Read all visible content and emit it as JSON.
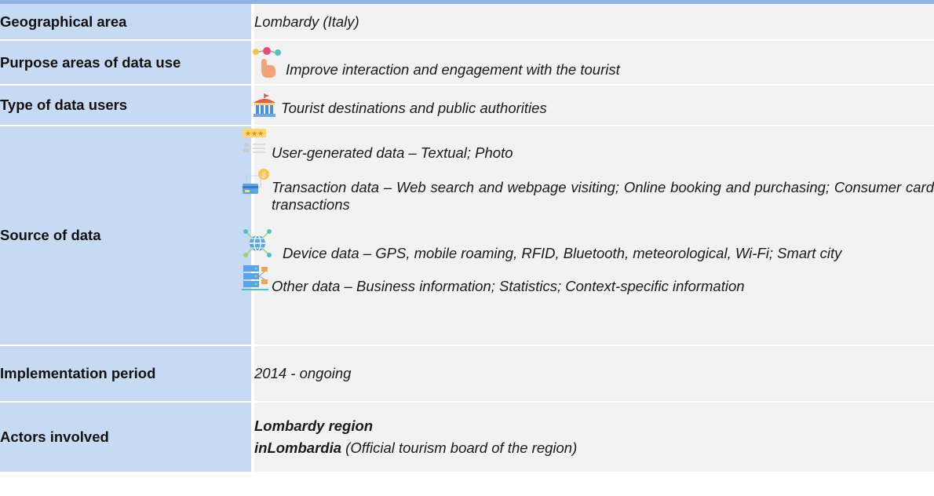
{
  "rows": {
    "geo": {
      "label": "Geographical area",
      "value": "Lombardy (Italy)"
    },
    "purpose": {
      "label": "Purpose areas of data use",
      "value": "Improve interaction and engagement with the tourist"
    },
    "users": {
      "label": "Type of data users",
      "value": "Tourist destinations and public authorities"
    },
    "source": {
      "label": "Source of data",
      "items": [
        {
          "icon": "review-stars-icon",
          "text": "User-generated data – Textual; Photo"
        },
        {
          "icon": "payment-card-icon",
          "text": "Transaction data – Web search and webpage visiting; Online booking and purchasing; Consumer card transactions"
        },
        {
          "icon": "globe-network-icon",
          "text": "Device data – GPS, mobile roaming, RFID, Bluetooth, meteorological, Wi-Fi; Smart city"
        },
        {
          "icon": "server-icon",
          "text": "Other data – Business information; Statistics; Context-specific information"
        }
      ]
    },
    "period": {
      "label": "Implementation period",
      "value": "2014 - ongoing"
    },
    "actors": {
      "label": "Actors involved",
      "line1": "Lombardy region",
      "line2_bold": "inLombardia",
      "line2_rest": " (Official tourism board of the region)"
    }
  },
  "colors": {
    "label_bg": "#c6daf3",
    "value_bg": "#f2f2f2",
    "top_border": "#8fb4e3"
  }
}
